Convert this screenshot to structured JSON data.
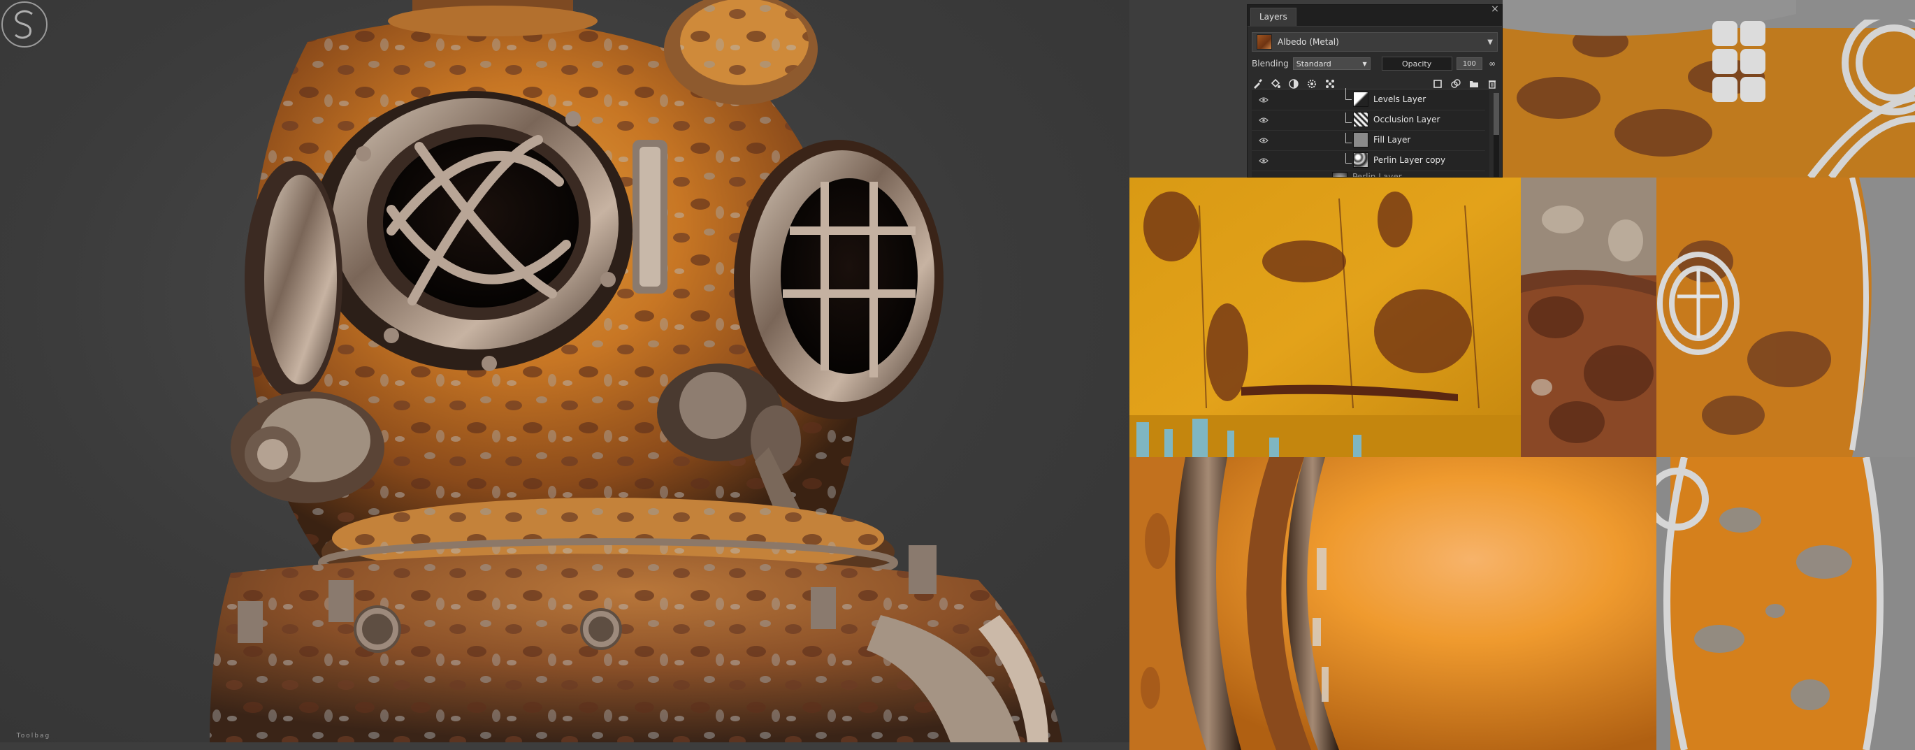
{
  "layers_panel": {
    "tab_label": "Layers",
    "close_glyph": "×",
    "channel": {
      "label": "Albedo (Metal)",
      "swatch_color": "#9a5220"
    },
    "blending_label": "Blending",
    "blending_mode": "Standard",
    "opacity_label": "Opacity",
    "opacity_value": "100",
    "toolbar_icons": [
      "paint-brush-icon",
      "fill-bucket-icon",
      "adjustment-icon",
      "settings-gear-icon",
      "scatter-icon",
      "new-layer-icon",
      "duplicate-layer-icon",
      "folder-icon",
      "trash-icon"
    ],
    "layers": [
      {
        "name": "Levels Layer",
        "type": "levels"
      },
      {
        "name": "Occlusion Layer",
        "type": "occlusion"
      },
      {
        "name": "Fill Layer",
        "type": "fill"
      },
      {
        "name": "Perlin Layer copy",
        "type": "perlin"
      },
      {
        "name": "Perlin Layer",
        "type": "perlin"
      }
    ]
  },
  "logo": {
    "monogram": "S",
    "caption": "Toolbag"
  },
  "colors": {
    "rust_orange": "#d98a1e",
    "deep_rust": "#6b3517",
    "metal_grey": "#8d8d8d",
    "background": "#3d3d3d",
    "panel_bg": "#2b2b2b"
  }
}
